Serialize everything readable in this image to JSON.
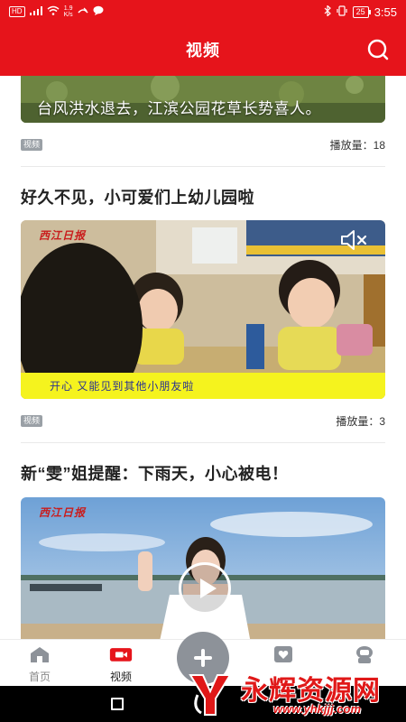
{
  "status_bar": {
    "left_chips": [
      "HD",
      "⁴ᴳ"
    ],
    "speed_value": "1.9",
    "speed_unit": "K/s",
    "battery": "25",
    "time": "3:55"
  },
  "header": {
    "title": "视频",
    "search_icon": "search-icon"
  },
  "feed": {
    "items": [
      {
        "title": "",
        "thumbnail_caption": "台风洪水退去，江滨公园花草长势喜人。",
        "tag": "视频",
        "plays": "播放量：18"
      },
      {
        "title": "好久不见，小可爱们上幼儿园啦",
        "logo_text": "西江日报",
        "subtitle": "开心  又能见到其他小朋友啦",
        "tag": "视频",
        "plays": "播放量：3",
        "mute_icon": "mute-icon"
      },
      {
        "title": "新“雯”姐提醒：下雨天，小心被电！",
        "logo_text": "西江日报",
        "play_icon": "play-icon"
      }
    ]
  },
  "tabbar": {
    "tabs": [
      {
        "label": "首页",
        "icon": "home-icon"
      },
      {
        "label": "视频",
        "icon": "video-icon",
        "active": true
      },
      {
        "label": "",
        "icon": "plus-icon"
      },
      {
        "label": "",
        "icon": "heart-card-icon"
      },
      {
        "label": "",
        "icon": "profile-icon"
      }
    ],
    "accent_color": "#e6141b"
  },
  "watermark": {
    "name": "永辉资源网",
    "url": "www.yhkjjj.com"
  }
}
